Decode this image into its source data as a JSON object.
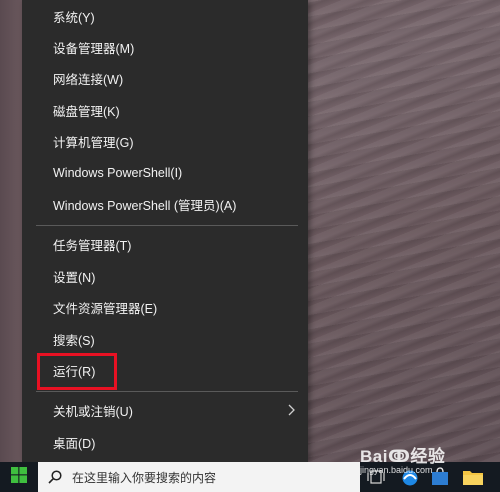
{
  "menu": {
    "items": [
      {
        "label": "系统(Y)"
      },
      {
        "label": "设备管理器(M)"
      },
      {
        "label": "网络连接(W)"
      },
      {
        "label": "磁盘管理(K)"
      },
      {
        "label": "计算机管理(G)"
      },
      {
        "label": "Windows PowerShell(I)"
      },
      {
        "label": "Windows PowerShell (管理员)(A)"
      },
      {
        "label": "任务管理器(T)"
      },
      {
        "label": "设置(N)"
      },
      {
        "label": "文件资源管理器(E)"
      },
      {
        "label": "搜索(S)"
      },
      {
        "label": "运行(R)",
        "highlighted": true
      },
      {
        "label": "关机或注销(U)",
        "has_submenu": true
      },
      {
        "label": "桌面(D)"
      }
    ],
    "highlight_color": "#e81123"
  },
  "taskbar": {
    "search_placeholder": "在这里输入你要搜索的内容",
    "icons": [
      "windows-start-icon",
      "search-icon",
      "task-view-icon",
      "browser-icon",
      "store-icon",
      "file-explorer-icon"
    ]
  },
  "watermark": {
    "main": "Baiↂ经验",
    "sub": "jingyan.baidu.com"
  }
}
